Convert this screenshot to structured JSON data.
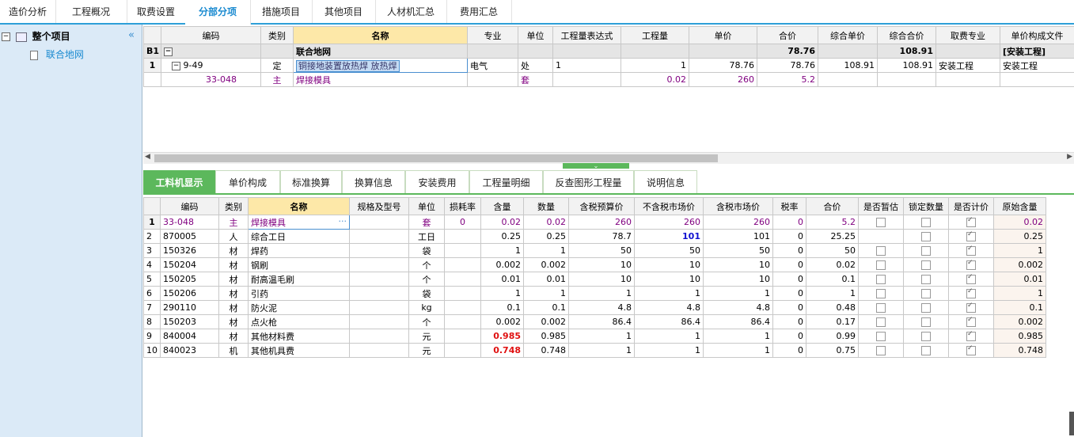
{
  "top_tabs": [
    "造价分析",
    "工程概况",
    "取费设置",
    "分部分项",
    "措施项目",
    "其他项目",
    "人材机汇总",
    "费用汇总"
  ],
  "tree": {
    "root": "整个项目",
    "child": "联合地网"
  },
  "upper": {
    "headers": [
      "编码",
      "类别",
      "名称",
      "专业",
      "单位",
      "工程量表达式",
      "工程量",
      "单价",
      "合价",
      "综合单价",
      "综合合价",
      "取费专业",
      "单价构成文件"
    ],
    "b1": {
      "idx": "B1",
      "name": "联合地网",
      "hejia": "78.76",
      "zonghe_hejia": "108.91",
      "file": "[安装工程]"
    },
    "row1": {
      "idx": "1",
      "code": "9-49",
      "type": "定",
      "name": "铜接地装置放热焊 放热焊",
      "major": "电气",
      "unit": "处",
      "expr": "1",
      "qty": "1",
      "price": "78.76",
      "hejia": "78.76",
      "zonghe_price": "108.91",
      "zonghe_hejia": "108.91",
      "fee_major": "安装工程",
      "file": "安装工程"
    },
    "row2": {
      "code": "33-048",
      "type": "主",
      "name": "焊接模具",
      "unit": "套",
      "qty": "0.02",
      "price": "260",
      "hejia": "5.2"
    }
  },
  "panel_tabs": [
    "工料机显示",
    "单价构成",
    "标准换算",
    "换算信息",
    "安装费用",
    "工程量明细",
    "反查图形工程量",
    "说明信息"
  ],
  "lower": {
    "headers": [
      "编码",
      "类别",
      "名称",
      "规格及型号",
      "单位",
      "损耗率",
      "含量",
      "数量",
      "含税预算价",
      "不含税市场价",
      "含税市场价",
      "税率",
      "合价",
      "是否暂估",
      "锁定数量",
      "是否计价",
      "原始含量"
    ],
    "rows": [
      {
        "idx": "1",
        "code": "33-048",
        "type": "主",
        "name": "焊接模具",
        "unit": "套",
        "loss": "0",
        "content": "0.02",
        "qty": "0.02",
        "tax_budget": "260",
        "notax_market": "260",
        "tax_market": "260",
        "rate": "0",
        "hejia": "5.2",
        "zangu": false,
        "lock": false,
        "jijia": true,
        "orig": "0.02"
      },
      {
        "idx": "2",
        "code": "870005",
        "type": "人",
        "name": "综合工日",
        "unit": "工日",
        "loss": "",
        "content": "0.25",
        "qty": "0.25",
        "tax_budget": "78.7",
        "notax_market": "101",
        "tax_market": "101",
        "rate": "0",
        "hejia": "25.25",
        "zangu": null,
        "lock": false,
        "jijia": true,
        "orig": "0.25"
      },
      {
        "idx": "3",
        "code": "150326",
        "type": "材",
        "name": "焊药",
        "unit": "袋",
        "loss": "",
        "content": "1",
        "qty": "1",
        "tax_budget": "50",
        "notax_market": "50",
        "tax_market": "50",
        "rate": "0",
        "hejia": "50",
        "zangu": false,
        "lock": false,
        "jijia": true,
        "orig": "1"
      },
      {
        "idx": "4",
        "code": "150204",
        "type": "材",
        "name": "钢刷",
        "unit": "个",
        "loss": "",
        "content": "0.002",
        "qty": "0.002",
        "tax_budget": "10",
        "notax_market": "10",
        "tax_market": "10",
        "rate": "0",
        "hejia": "0.02",
        "zangu": false,
        "lock": false,
        "jijia": true,
        "orig": "0.002"
      },
      {
        "idx": "5",
        "code": "150205",
        "type": "材",
        "name": "耐高温毛刷",
        "unit": "个",
        "loss": "",
        "content": "0.01",
        "qty": "0.01",
        "tax_budget": "10",
        "notax_market": "10",
        "tax_market": "10",
        "rate": "0",
        "hejia": "0.1",
        "zangu": false,
        "lock": false,
        "jijia": true,
        "orig": "0.01"
      },
      {
        "idx": "6",
        "code": "150206",
        "type": "材",
        "name": "引药",
        "unit": "袋",
        "loss": "",
        "content": "1",
        "qty": "1",
        "tax_budget": "1",
        "notax_market": "1",
        "tax_market": "1",
        "rate": "0",
        "hejia": "1",
        "zangu": false,
        "lock": false,
        "jijia": true,
        "orig": "1"
      },
      {
        "idx": "7",
        "code": "290110",
        "type": "材",
        "name": "防火泥",
        "unit": "kg",
        "loss": "",
        "content": "0.1",
        "qty": "0.1",
        "tax_budget": "4.8",
        "notax_market": "4.8",
        "tax_market": "4.8",
        "rate": "0",
        "hejia": "0.48",
        "zangu": false,
        "lock": false,
        "jijia": true,
        "orig": "0.1"
      },
      {
        "idx": "8",
        "code": "150203",
        "type": "材",
        "name": "点火枪",
        "unit": "个",
        "loss": "",
        "content": "0.002",
        "qty": "0.002",
        "tax_budget": "86.4",
        "notax_market": "86.4",
        "tax_market": "86.4",
        "rate": "0",
        "hejia": "0.17",
        "zangu": false,
        "lock": false,
        "jijia": true,
        "orig": "0.002"
      },
      {
        "idx": "9",
        "code": "840004",
        "type": "材",
        "name": "其他材料费",
        "unit": "元",
        "loss": "",
        "content": "0.985",
        "qty": "0.985",
        "tax_budget": "1",
        "notax_market": "1",
        "tax_market": "1",
        "rate": "0",
        "hejia": "0.99",
        "zangu": false,
        "lock": false,
        "jijia": true,
        "orig": "0.985"
      },
      {
        "idx": "10",
        "code": "840023",
        "type": "机",
        "name": "其他机具费",
        "unit": "元",
        "loss": "",
        "content": "0.748",
        "qty": "0.748",
        "tax_budget": "1",
        "notax_market": "1",
        "tax_market": "1",
        "rate": "0",
        "hejia": "0.75",
        "zangu": false,
        "lock": false,
        "jijia": true,
        "orig": "0.748"
      }
    ]
  }
}
